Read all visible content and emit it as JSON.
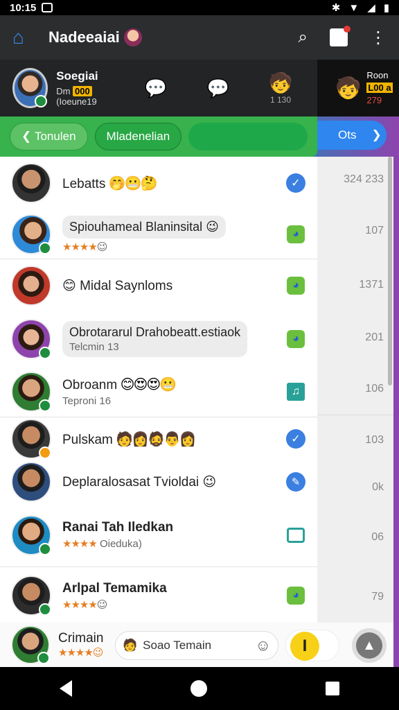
{
  "status_bar": {
    "time": "10:15"
  },
  "app_bar": {
    "title": "Nadeeaiai"
  },
  "stories": {
    "main_name": "Soegiai",
    "main_sub_prefix": "Dm",
    "main_sub_badge": "000",
    "main_sub_suffix": "(Ioeune19",
    "middle_label": "1 130",
    "right_top": "Roon",
    "right_badge": "L00 a",
    "right_count": "279"
  },
  "chips": {
    "back_label": "Tonulen",
    "active_label": "Mladenelian",
    "right_label": "Ots"
  },
  "chats": [
    {
      "name": "Lebatts",
      "emoji": "🤭😬🤔",
      "side": "324 233"
    },
    {
      "bubble": "Spiouhameal Blaninsital 😉",
      "sub_emoji": "😉",
      "side": "107"
    },
    {
      "name": "😊 Midal Saynloms",
      "side": "1371"
    },
    {
      "bubble": "Obrotararul Drahobeatt.estiaok",
      "bubble_sub": "Telcmin 13",
      "side": "201"
    },
    {
      "name": "Obroanm",
      "emoji": "😊😍😍😬",
      "sub": "Teproni 16",
      "side": "106"
    },
    {
      "name": "Pulskam",
      "side": "103"
    },
    {
      "name": "Deplaralosasat Tvioldai 😉",
      "side": "0k"
    },
    {
      "name": "Ranai Tah Iledkan",
      "sub": "Oieduka)",
      "side": "06"
    },
    {
      "name": "Arlpal Temamika",
      "side": "79"
    }
  ],
  "composer": {
    "name": "Crimain",
    "input_placeholder": "Soao Temain",
    "action_letter": "I"
  }
}
